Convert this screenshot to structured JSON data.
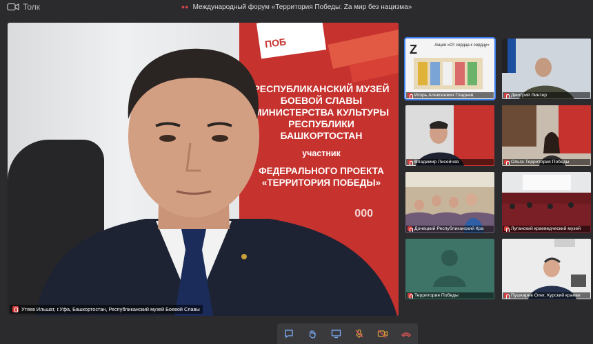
{
  "app": {
    "name": "Толк"
  },
  "meeting": {
    "title": "Международный форум «Территория Победы: Za мир без нацизма»"
  },
  "main_speaker": {
    "caption": "Утяев Ильшат, г.Уфа, Башкортостан, Республиканский музей Боевой Славы",
    "banner": {
      "badge": "ПОБ",
      "line1": "РЕСПУБЛИКАНСКИЙ МУЗЕЙ БОЕВОЙ СЛАВЫ МИНИСТЕРСТВА КУЛЬТУРЫ РЕСПУБЛИКИ БАШКОРТОСТАН",
      "line2": "участник",
      "line3": "ФЕДЕРАЛЬНОГО ПРОЕКТА «ТЕРРИТОРИЯ ПОБЕДЫ»",
      "line4": "000"
    }
  },
  "tile_signs": {
    "action": "Акция «От сердца к сердцу»",
    "logo": "Z",
    "banner_small": "ТЕРРИТОРИЯ ПОБЕДЫ"
  },
  "participants": [
    {
      "name": "Игорь Алексеевич Гладнев"
    },
    {
      "name": "Дмитрий Линтер"
    },
    {
      "name": "Владимир Лисейчев"
    },
    {
      "name": "Ольга Территория Победы"
    },
    {
      "name": "Донецкий Республиканский Кра"
    },
    {
      "name": "Луганский краеведческий музей"
    },
    {
      "name": "Территория Победы"
    },
    {
      "name": "Пушкарев Олег, Курский краеве"
    }
  ],
  "colors": {
    "accent": "#3d7ff0",
    "mic_muted": "#d23b3b",
    "banner": "#c6322e",
    "hangup": "#e05555"
  },
  "toolbar": {
    "icons": [
      "chat-icon",
      "raise-hand-icon",
      "screen-share-icon",
      "microphone-off-icon",
      "camera-off-icon",
      "hang-up-icon"
    ]
  }
}
